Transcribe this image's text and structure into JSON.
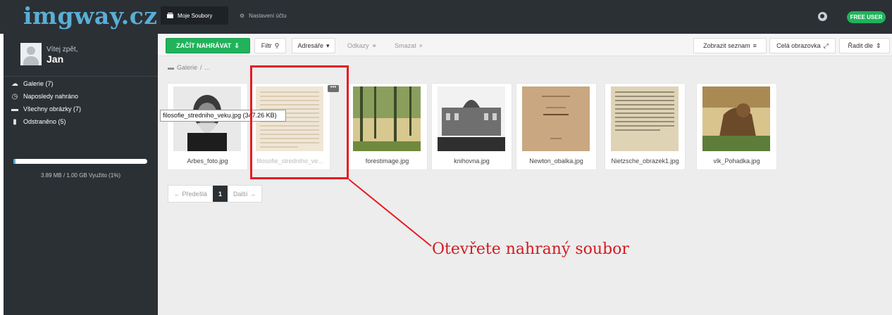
{
  "header": {
    "logo_text": "imgway.cz",
    "tabs": [
      {
        "label": "Moje Soubory",
        "icon": "images-icon",
        "active": true
      },
      {
        "label": "Nastavení účtu",
        "icon": "gear-icon",
        "active": false
      }
    ],
    "language_icon": "globe-icon",
    "plan_badge": "FREE USER",
    "plan_badge_color": "#20b35b"
  },
  "sidebar": {
    "welcome": "Vítej zpět,",
    "username": "Jan",
    "items": [
      {
        "label": "Galerie (7)",
        "icon": "cloud-icon"
      },
      {
        "label": "Naposledy nahráno",
        "icon": "clock-icon"
      },
      {
        "label": "Všechny obrázky (7)",
        "icon": "images-icon"
      },
      {
        "label": "Odstraněno (5)",
        "icon": "trash-icon"
      }
    ],
    "storage_text": "3.89 MB / 1.00 GB Využito (1%)",
    "storage_percent": 1
  },
  "toolbar": {
    "upload_label": "ZAČÍT NAHRÁVAT",
    "filter_label": "Filtr",
    "folder_label": "Adresáře",
    "links_label": "Odkazy",
    "delete_label": "Smazat",
    "list_view_label": "Zobrazit seznam",
    "fullscreen_label": "Celá obrazovka",
    "sort_label": "Řadit dle"
  },
  "breadcrumb": {
    "root": "Galerie",
    "separator": "/",
    "trail": "..."
  },
  "files": [
    {
      "name": "Arbes_foto.jpg",
      "thumb": "portrait"
    },
    {
      "name": "filosofie_stredniho_ve...",
      "thumb": "text-page"
    },
    {
      "name": "forestimage.jpg",
      "thumb": "forest"
    },
    {
      "name": "knihovna.jpg",
      "thumb": "building"
    },
    {
      "name": "Newton_obalka.jpg",
      "thumb": "book-cover"
    },
    {
      "name": "Nietzsche_obrazek1.jpg",
      "thumb": "text-page"
    },
    {
      "name": "vlk_Pohadka.jpg",
      "thumb": "illustration"
    }
  ],
  "tooltip": "filosofie_stredniho_veku.jpg (347.26 KB)",
  "pagination": {
    "prev": "← Předešlá",
    "current": "1",
    "next": "Další →"
  },
  "annotation": {
    "label": "Otevřete nahraný soubor",
    "color": "#e51c23"
  }
}
